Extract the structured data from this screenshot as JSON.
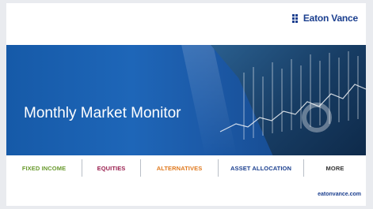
{
  "brand": {
    "name": "Eaton Vance",
    "icon": "grid-logo-icon",
    "color": "#1b3f8f"
  },
  "banner": {
    "title": "Monthly Market Monitor"
  },
  "nav": {
    "items": [
      {
        "label": "FIXED INCOME",
        "color": "#6a9a2e"
      },
      {
        "label": "EQUITIES",
        "color": "#9a1f4f"
      },
      {
        "label": "ALTERNATIVES",
        "color": "#e07a1f"
      },
      {
        "label": "ASSET ALLOCATION",
        "color": "#1b3f8f"
      },
      {
        "label": "MORE",
        "color": "#333333"
      }
    ]
  },
  "footer": {
    "url": "eatonvance.com"
  }
}
